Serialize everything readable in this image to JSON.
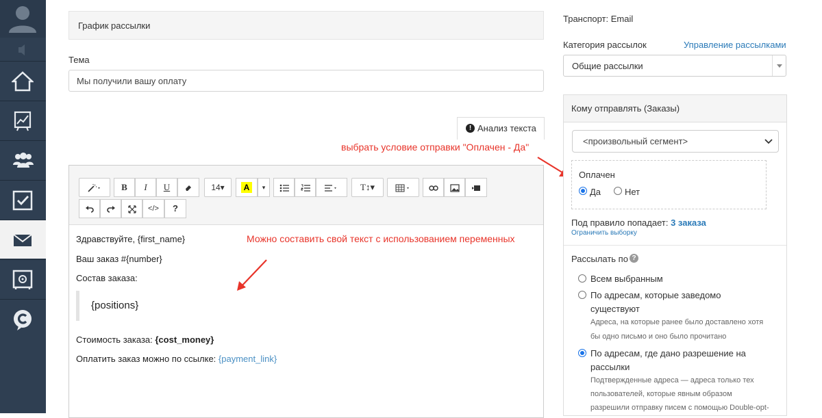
{
  "sidebar": {
    "items": [
      {
        "name": "home"
      },
      {
        "name": "analytics"
      },
      {
        "name": "contacts"
      },
      {
        "name": "tasks"
      },
      {
        "name": "mailings",
        "active": true
      },
      {
        "name": "safe"
      },
      {
        "name": "brand"
      }
    ]
  },
  "main": {
    "schedule_header": "График рассылки",
    "subject_label": "Тема",
    "subject_value": "Мы получили вашу оплату",
    "analysis_tab_label": "Анализ текста",
    "toolbar": {
      "font_size": "14▾"
    },
    "content": {
      "greeting_prefix": "Здравствуйте, ",
      "greeting_var": "{first_name}",
      "order_line": "Ваш заказ #{number}",
      "composition_label": "Состав заказа:",
      "positions_var": "{positions}",
      "cost_label": "Стоимость заказа: ",
      "cost_var": "{cost_money}",
      "pay_label": "Оплатить заказ можно по ссылке: ",
      "pay_var": "{payment_link}"
    }
  },
  "annotations": {
    "condition_note": "выбрать условие отправки \"Оплачен - Да\"",
    "text_note": "Можно составить свой текст с использованием переменных"
  },
  "right": {
    "transport": "Транспорт: Email",
    "category_label": "Категория рассылок",
    "manage_link": "Управление рассылками",
    "category_value": "Общие рассылки",
    "recipients_header": "Кому отправлять (Заказы)",
    "segment_value": "<произвольный сегмент>",
    "paid": {
      "label": "Оплачен",
      "yes": "Да",
      "no": "Нет",
      "selected": "yes"
    },
    "rule_prefix": "Под правило попадает:",
    "rule_count": "3 заказа",
    "limit_link": "Ограничить выборку",
    "send_to_label": "Рассылать по",
    "options": [
      {
        "label": "Всем выбранным",
        "selected": false
      },
      {
        "label_line1": "По адресам, которые заведомо",
        "label_line2": "существуют",
        "desc_line1": "Адреса, на которые ранее было доставлено хотя",
        "desc_line2": "бы одно письмо и оно было прочитано",
        "selected": false
      },
      {
        "label_line1": "По адресам, где дано разрешение на",
        "label_line2": "рассылки",
        "desc_line1": "Подтвержденные адреса — адреса только тех",
        "desc_line2": "пользователей, которые явным образом",
        "desc_line3": "разрешили отправку писем с помощью Double-opt-",
        "selected": true
      }
    ]
  },
  "colors": {
    "sidebar_bg": "#2f3f52",
    "annotation_red": "#e8342a",
    "link_blue": "#2a7ab8",
    "variable_blue": "#4a90c4"
  }
}
